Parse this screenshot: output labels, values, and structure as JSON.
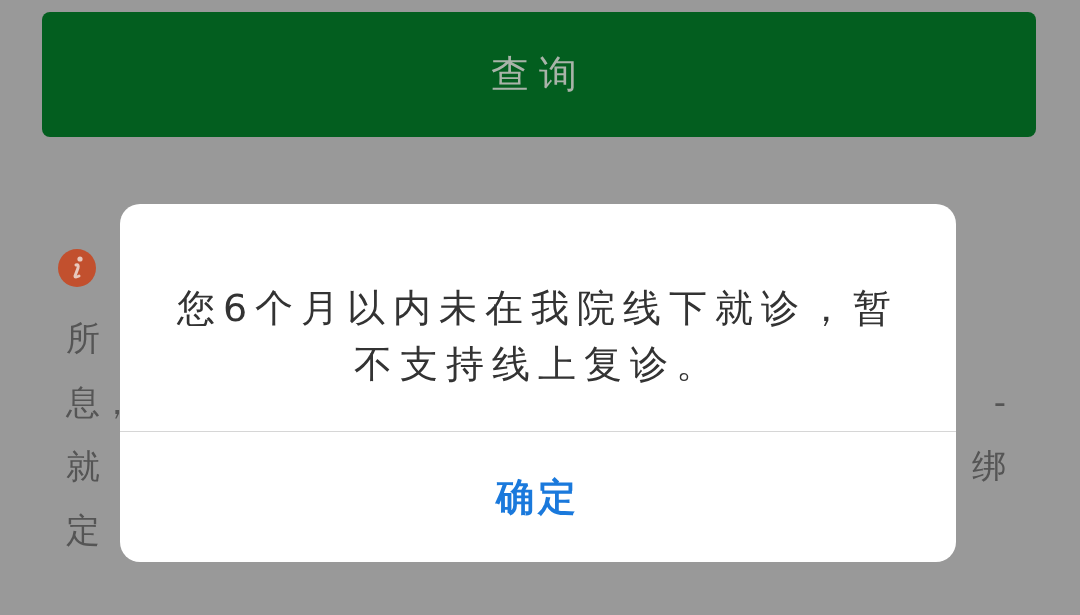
{
  "query_button": {
    "label": "查询"
  },
  "notice": {
    "lines": [
      {
        "left": "所"
      },
      {
        "left": "息，",
        "right": "-"
      },
      {
        "left": "就",
        "right": "绑"
      },
      {
        "left": "定"
      }
    ]
  },
  "dialog": {
    "message": "您6个月以内未在我院线下就诊，暂不支持线上复诊。",
    "button": "确定"
  }
}
